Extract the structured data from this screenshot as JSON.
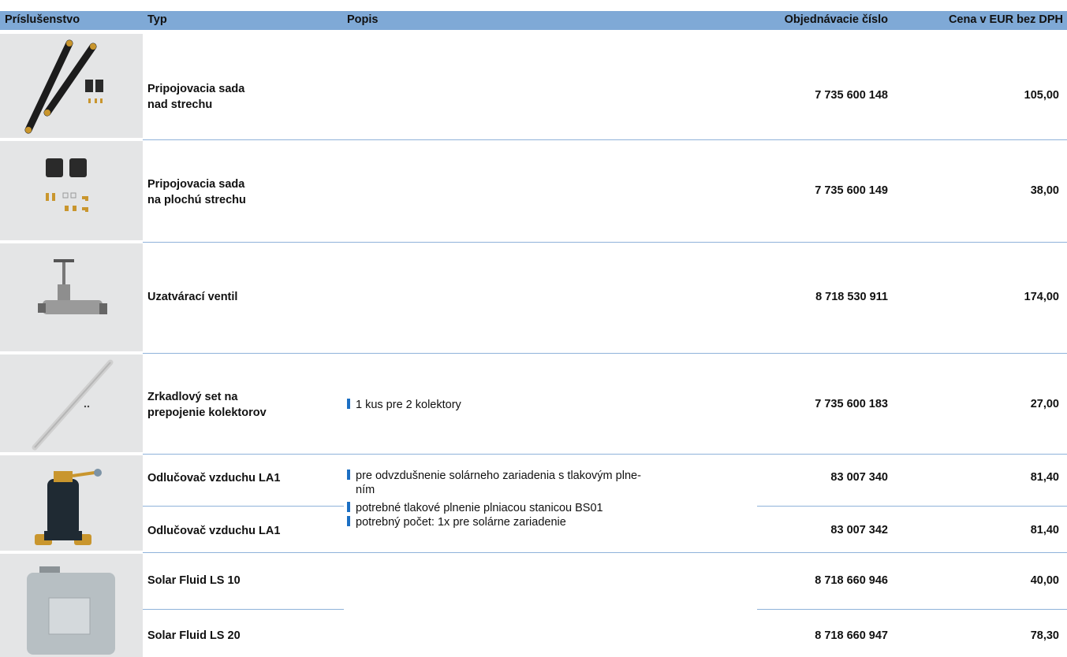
{
  "header": {
    "prislusenstvo": "Príslušenstvo",
    "typ": "Typ",
    "popis": "Popis",
    "objednavacie_cislo": "Objednávacie číslo",
    "cena": "Cena v EUR bez DPH"
  },
  "rows": [
    {
      "typ_line1": "Pripojovacia sada",
      "typ_line2": "nad strechu",
      "order_no": "7 735 600 148",
      "price": "105,00",
      "image": "connection-set-over-roof-image"
    },
    {
      "typ_line1": "Pripojovacia sada",
      "typ_line2": "na plochú strechu",
      "order_no": "7 735 600 149",
      "price": "38,00",
      "image": "connection-set-flat-roof-image"
    },
    {
      "typ": "Uzatvárací ventil",
      "order_no": "8 718 530 911",
      "price": "174,00",
      "image": "shutoff-valve-image"
    },
    {
      "typ_line1": "Zrkadlový set na",
      "typ_line2": "prepojenie kolektorov",
      "popis": "1 kus pre 2 kolektory",
      "order_no": "7 735 600 183",
      "price": "27,00",
      "image": "mirror-set-image"
    },
    {
      "typ": "Odlučovač vzduchu LA1",
      "order_no": "83 007 340",
      "price": "81,40",
      "image": "air-separator-image"
    },
    {
      "typ": "Odlučovač vzduchu LA1",
      "order_no": "83 007 342",
      "price": "81,40"
    },
    {
      "typ": "Solar Fluid LS 10",
      "order_no": "8 718 660 946",
      "price": "40,00",
      "image": "solar-fluid-canister-image"
    },
    {
      "typ": "Solar Fluid LS 20",
      "order_no": "8 718 660 947",
      "price": "78,30"
    }
  ],
  "air_separator_desc": {
    "b1_line1": "pre odvzdušnenie solárneho zariadenia s tlakovým plne-",
    "b1_line2": "ním",
    "b2": "potrebné tlakové plnenie plniacou stanicou BS01",
    "b3": "potrebný počet: 1x pre solárne zariadenie"
  },
  "colors": {
    "header_bg": "#7fa9d6",
    "bullet": "#1c6fc3",
    "row_line": "#8fb2da",
    "image_bg": "#e4e5e6"
  }
}
